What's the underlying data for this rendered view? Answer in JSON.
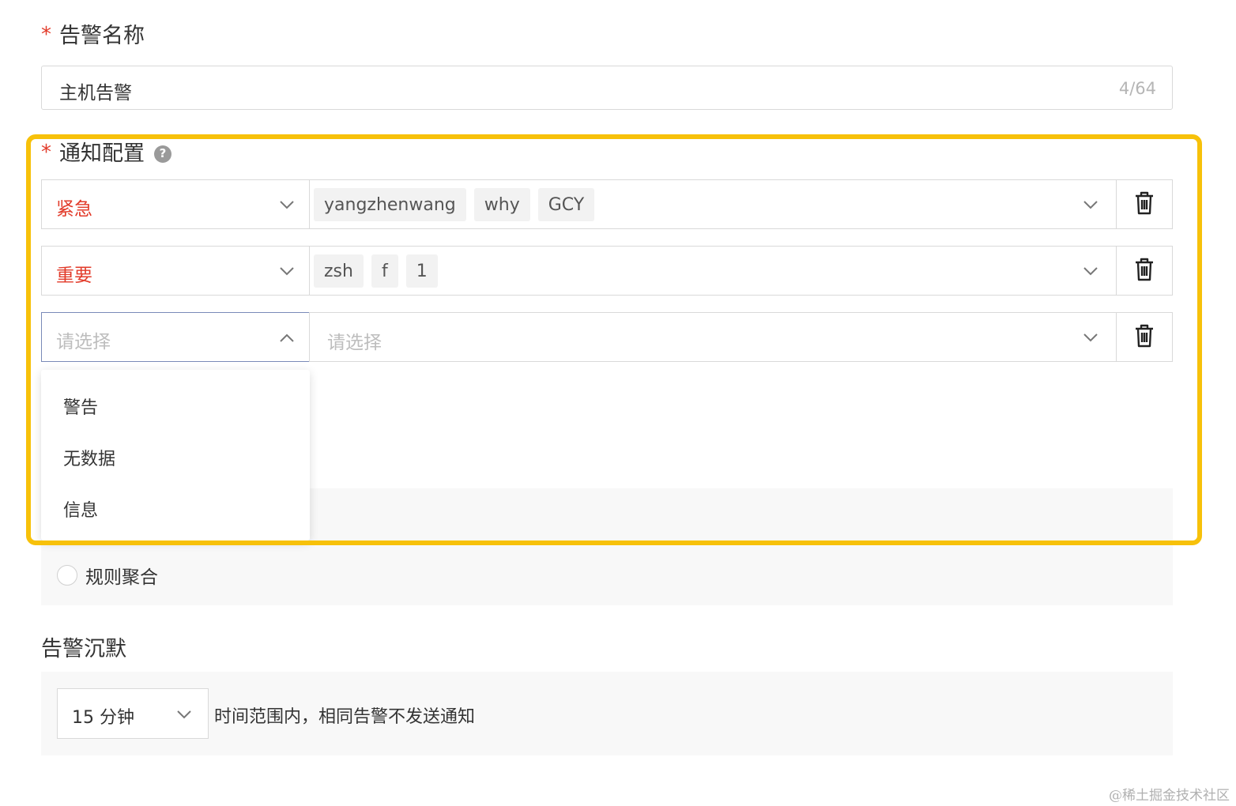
{
  "alert_name": {
    "label": "告警名称",
    "value": "主机告警",
    "counter": "4/64"
  },
  "notify": {
    "label": "通知配置",
    "help_icon": "?",
    "rows": [
      {
        "level": "紧急",
        "users": [
          "yangzhenwang",
          "why",
          "GCY"
        ]
      },
      {
        "level": "重要",
        "users": [
          "zsh",
          "f",
          "1"
        ]
      },
      {
        "level_placeholder": "请选择",
        "users_placeholder": "请选择"
      }
    ],
    "level_options": [
      "警告",
      "无数据",
      "信息"
    ]
  },
  "aggregation": {
    "option_label": "规则聚合"
  },
  "silence": {
    "label": "告警沉默",
    "duration": "15 分钟",
    "description": "时间范围内，相同告警不发送通知"
  },
  "watermark": "@稀土掘金技术社区",
  "colors": {
    "required": "#e23b2a",
    "highlight": "#f7c10a"
  }
}
